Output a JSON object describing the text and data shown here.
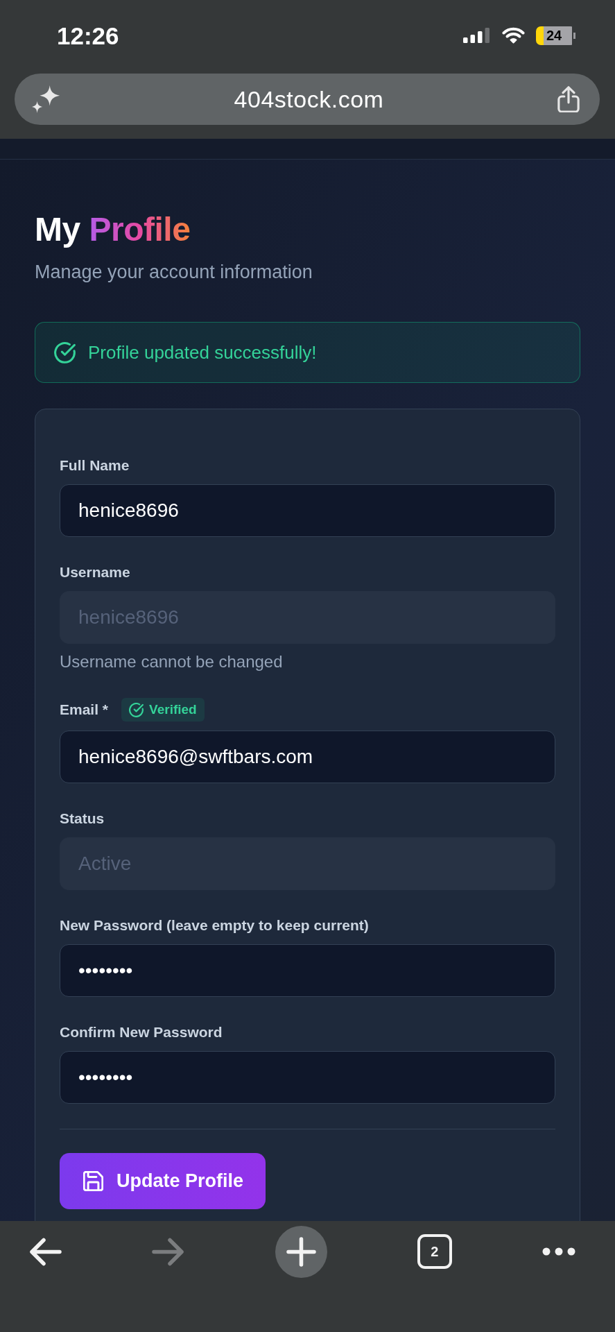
{
  "status_bar": {
    "time": "12:26",
    "battery": "24"
  },
  "address_bar": {
    "url": "404stock.com"
  },
  "page": {
    "title": "My **Profile**",
    "subtitle": "Manage your account information"
  },
  "alert": {
    "kind": "success",
    "message": "Profile updated successfully!"
  },
  "form": {
    "fields": [
      {
        "label": "Full Name",
        "value": "henice8696",
        "disabled": false
      },
      {
        "label": "Username",
        "value": "henice8696",
        "disabled": true,
        "help": "Username cannot be changed"
      },
      {
        "label": "Email *",
        "value": "henice8696@swftbars.com",
        "disabled": false,
        "badge": "Verified"
      },
      {
        "label": "Status",
        "value": "Active",
        "disabled": true
      },
      {
        "label": "New Password (leave empty to keep current)",
        "value": "••••••••",
        "disabled": false
      },
      {
        "label": "Confirm New Password",
        "value": "••••••••",
        "disabled": false
      }
    ],
    "submit": "Update Profile"
  },
  "toolbar": [
    {
      "kind": "back",
      "disabled": false
    },
    {
      "kind": "forward",
      "disabled": true
    },
    {
      "kind": "new-tab",
      "disabled": false
    },
    {
      "kind": "tabs",
      "label": "2",
      "disabled": false
    },
    {
      "kind": "more",
      "disabled": false
    }
  ]
}
